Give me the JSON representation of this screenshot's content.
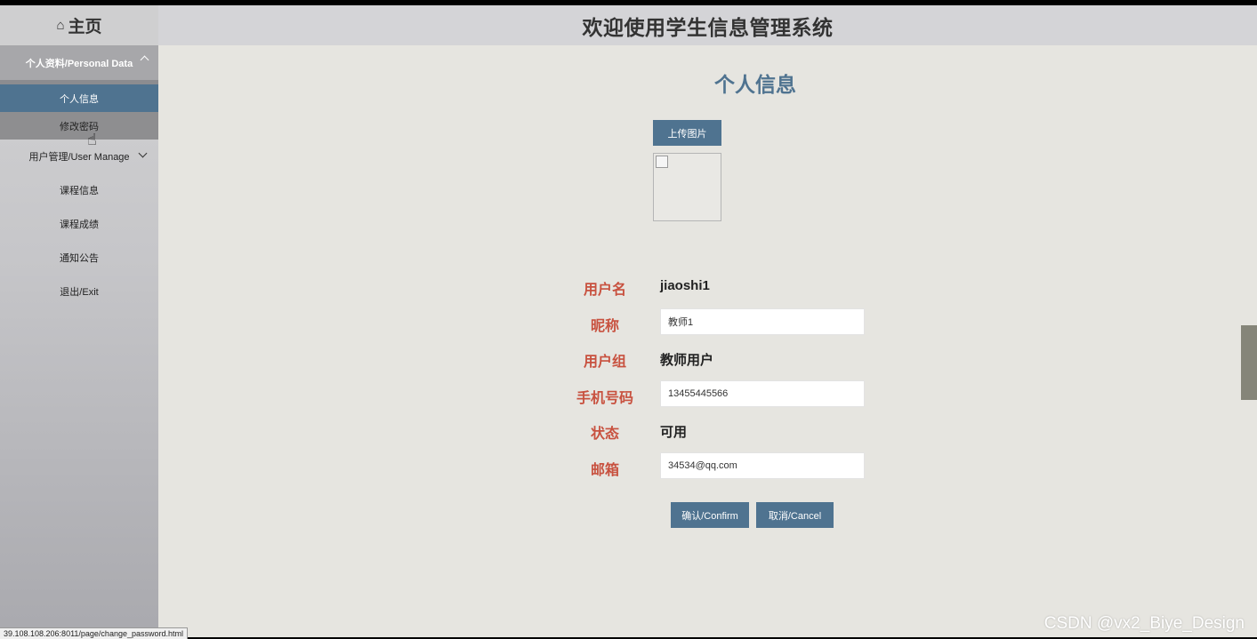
{
  "sidebar": {
    "home_label": "主页",
    "home_icon": "home-icon",
    "group": {
      "label": "个人资料/Personal Data",
      "expanded": true
    },
    "sub_items": [
      {
        "label": "个人信息",
        "state": "active"
      },
      {
        "label": "修改密码",
        "state": "hover"
      }
    ],
    "items": [
      {
        "label": "用户管理/User Manage",
        "has_chevron": true
      },
      {
        "label": "课程信息"
      },
      {
        "label": "课程成绩"
      },
      {
        "label": "通知公告"
      },
      {
        "label": "退出/Exit"
      }
    ]
  },
  "header": {
    "title": "欢迎使用学生信息管理系统"
  },
  "main": {
    "page_title": "个人信息",
    "upload_label": "上传图片",
    "fields": {
      "username": {
        "label": "用户名",
        "value": "jiaoshi1"
      },
      "nickname": {
        "label": "昵称",
        "value": "教师1"
      },
      "group": {
        "label": "用户组",
        "value": "教师用户"
      },
      "phone": {
        "label": "手机号码",
        "value": "13455445566"
      },
      "status": {
        "label": "状态",
        "value": "可用"
      },
      "email": {
        "label": "邮箱",
        "value": "34534@qq.com"
      }
    },
    "confirm_label": "确认/Confirm",
    "cancel_label": "取消/Cancel"
  },
  "status_bar": {
    "url": "39.108.108.206:8011/page/change_password.html"
  },
  "watermark": "CSDN @vx2_Biye_Design",
  "colors": {
    "accent": "#4f7390",
    "label_red": "#c8513f",
    "background": "#e6e5e0"
  }
}
